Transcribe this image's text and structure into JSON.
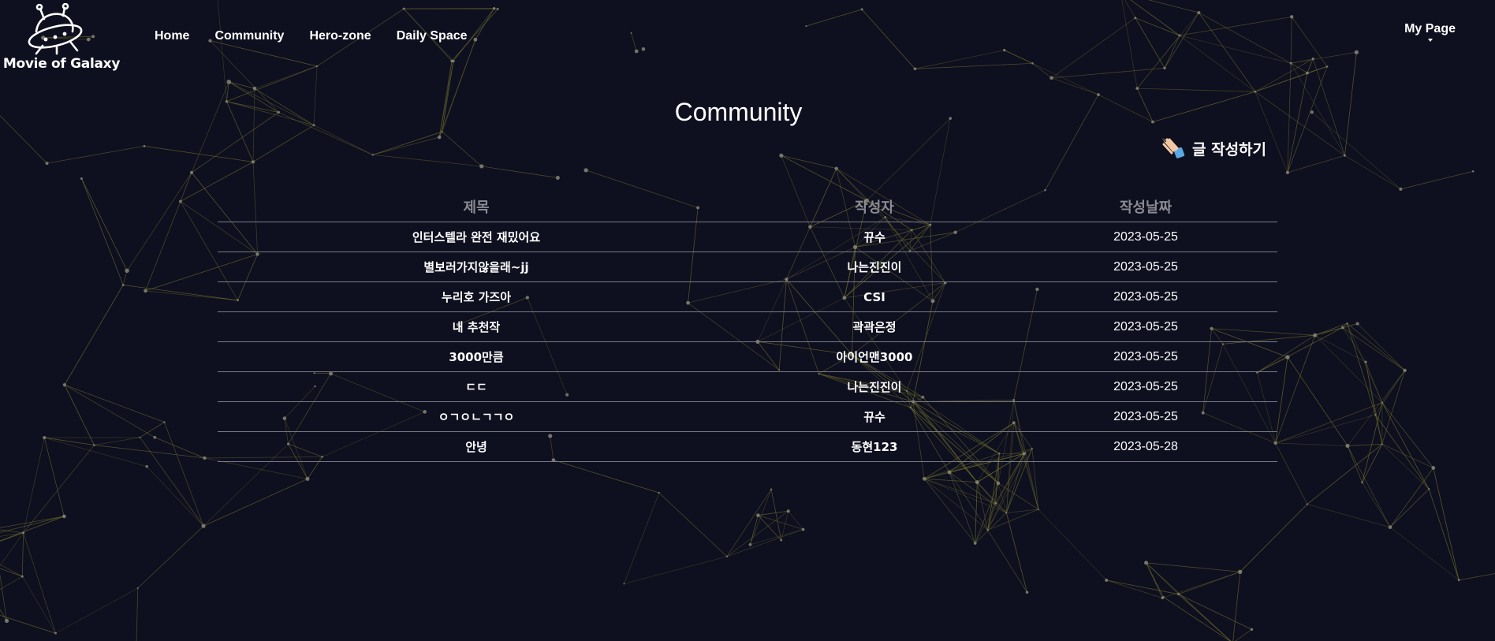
{
  "brand": {
    "name": "Movie of Galaxy",
    "logo_icon": "ufo-icon"
  },
  "nav": {
    "items": [
      {
        "label": "Home"
      },
      {
        "label": "Community"
      },
      {
        "label": "Hero-zone"
      },
      {
        "label": "Daily Space"
      }
    ],
    "mypage_label": "My Page"
  },
  "page": {
    "title": "Community",
    "write_label": "글 작성하기",
    "write_icon": "writing-hand-icon"
  },
  "table": {
    "columns": [
      "제목",
      "작성자",
      "작성날짜"
    ],
    "rows": [
      {
        "title": "인터스텔라 완전 재밌어요",
        "author": "뀨수",
        "date": "2023-05-25"
      },
      {
        "title": "별보러가지않을래~jj",
        "author": "나는진진이",
        "date": "2023-05-25"
      },
      {
        "title": "누리호 가즈아",
        "author": "CSI",
        "date": "2023-05-25"
      },
      {
        "title": "내 추천작",
        "author": "곽곽은정",
        "date": "2023-05-25"
      },
      {
        "title": "3000만큼",
        "author": "아이언맨3000",
        "date": "2023-05-25"
      },
      {
        "title": "ㄷㄷ",
        "author": "나는진진이",
        "date": "2023-05-25"
      },
      {
        "title": "ㅇㄱㅇㄴㄱㄱㅇ",
        "author": "뀨수",
        "date": "2023-05-25"
      },
      {
        "title": "안녕",
        "author": "동현123",
        "date": "2023-05-28"
      }
    ]
  },
  "colors": {
    "background": "#0e0f1f",
    "network_line": "#6b6a2c",
    "network_node": "#8c8c7c",
    "header_text": "#8a8b93",
    "divider": "#7a7c88"
  }
}
